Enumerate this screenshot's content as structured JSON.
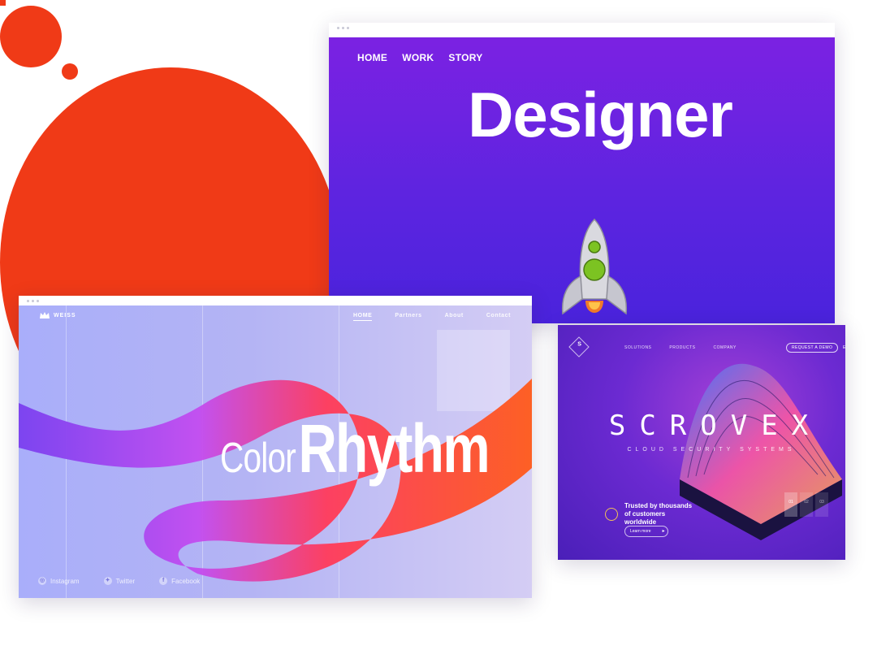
{
  "designer": {
    "nav": [
      "HOME",
      "WORK",
      "STORY"
    ],
    "title": "Designer"
  },
  "weiss": {
    "logo": "WEISS",
    "nav": [
      "HOME",
      "Partners",
      "About",
      "Contact"
    ],
    "title_light": "Color",
    "title_bold": "Rhythm",
    "social": [
      "Instagram",
      "Twitter",
      "Facebook"
    ]
  },
  "scrovex": {
    "logo": "S",
    "nav": [
      "SOLUTIONS",
      "PRODUCTS",
      "COMPANY"
    ],
    "demo_button": "REQUEST A DEMO",
    "language": "EN",
    "title": "SCROVEX",
    "subtitle": "CLOUD SECURITY SYSTEMS",
    "trust_text": "Trusted by thousands of customers worldwide",
    "learn_button": "Learn more",
    "pager": [
      "01",
      "02",
      "03"
    ]
  },
  "colors": {
    "accent_orange": "#f03a17",
    "designer_purple": "#6a22e0",
    "weiss_lavender": "#b0b2f8",
    "scrovex_purple": "#6c2ad2"
  }
}
